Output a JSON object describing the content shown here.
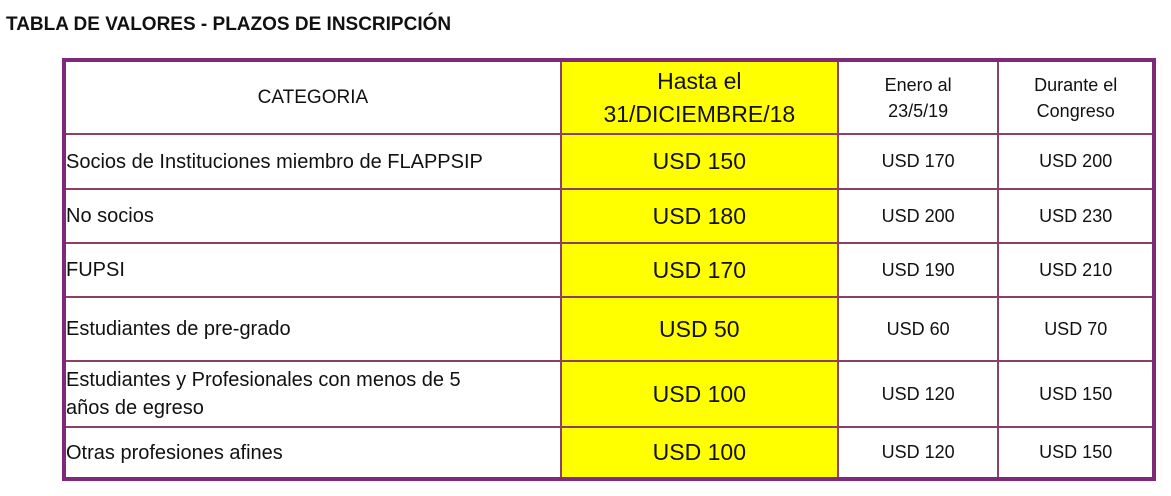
{
  "title": "TABLA DE VALORES - PLAZOS DE INSCRIPCIÓN",
  "table": {
    "headers": {
      "categoria": "CATEGORIA",
      "diciembre": [
        "Hasta el",
        "31/DICIEMBRE/18"
      ],
      "enero": [
        "Enero al",
        "23/5/19"
      ],
      "congreso": [
        "Durante el",
        "Congreso"
      ]
    },
    "rows": [
      {
        "categoria": [
          "Socios de Instituciones miembro de  FLAPPSIP"
        ],
        "diciembre": "USD 150",
        "enero": "USD 170",
        "congreso": "USD 200"
      },
      {
        "categoria": [
          "No socios"
        ],
        "diciembre": "USD 180",
        "enero": "USD 200",
        "congreso": "USD 230"
      },
      {
        "categoria": [
          "FUPSI"
        ],
        "diciembre": "USD 170",
        "enero": "USD 190",
        "congreso": "USD 210"
      },
      {
        "categoria": [
          "Estudiantes de pre-grado"
        ],
        "diciembre": "USD 50",
        "enero": "USD 60",
        "congreso": "USD 70"
      },
      {
        "categoria": [
          "Estudiantes y Profesionales con menos de 5",
          "años de egreso"
        ],
        "diciembre": "USD 100",
        "enero": "USD 120",
        "congreso": "USD 150"
      },
      {
        "categoria": [
          "Otras profesiones afines"
        ],
        "diciembre": "USD 100",
        "enero": "USD 120",
        "congreso": "USD 150"
      }
    ]
  },
  "colors": {
    "border": "#7d2a7a",
    "highlight": "#ffff00"
  }
}
